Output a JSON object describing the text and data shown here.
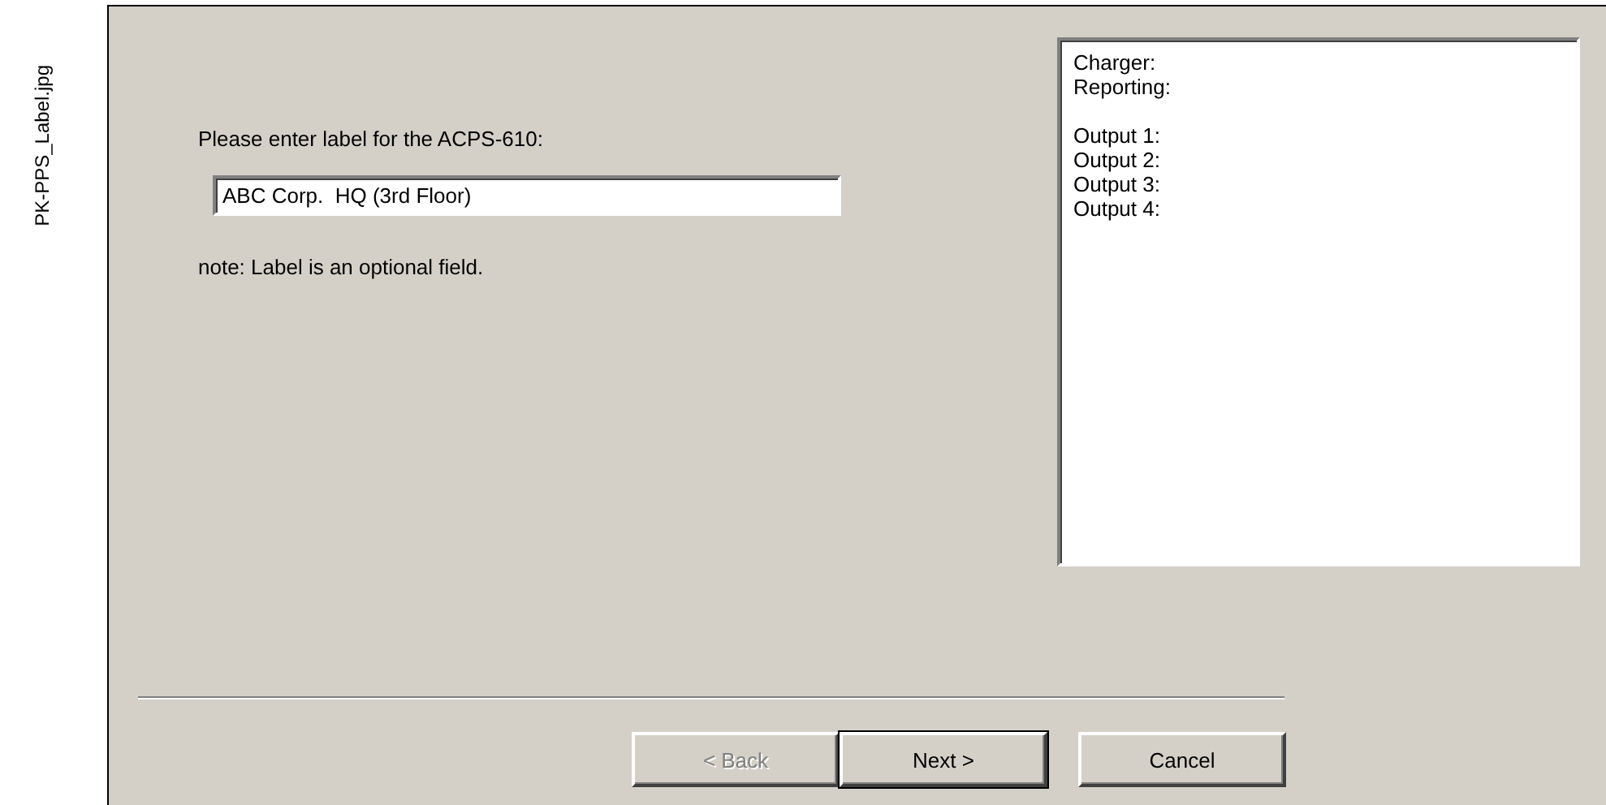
{
  "file_label": "PK-PPS_Label.jpg",
  "form": {
    "prompt": "Please enter label for the ACPS-610:",
    "label_field": {
      "value": "ABC Corp.  HQ (3rd Floor)"
    },
    "note": "note: Label is an optional field."
  },
  "summary": {
    "groups": [
      [
        "Charger:",
        "Reporting:"
      ],
      [
        "Output 1:",
        "Output 2:",
        "Output 3:",
        "Output 4:"
      ]
    ]
  },
  "buttons": [
    {
      "label": "< Back",
      "disabled": true,
      "default": false
    },
    {
      "label": "Next >",
      "disabled": false,
      "default": true
    },
    {
      "label": "Cancel",
      "disabled": false,
      "default": false
    }
  ]
}
